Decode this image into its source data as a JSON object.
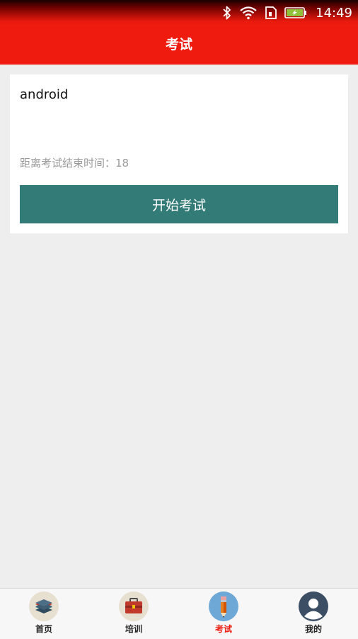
{
  "status_bar": {
    "time": "14:49",
    "icons": [
      "bluetooth-icon",
      "wifi-icon",
      "sim-icon",
      "battery-charging-icon"
    ]
  },
  "app_bar": {
    "title": "考试"
  },
  "exam_card": {
    "name": "android",
    "countdown_label": "距离考试结束时间：",
    "countdown_value": "18",
    "start_button_label": "开始考试"
  },
  "bottom_nav": {
    "items": [
      {
        "label": "首页",
        "icon": "layers-icon",
        "active": false
      },
      {
        "label": "培训",
        "icon": "briefcase-icon",
        "active": false
      },
      {
        "label": "考试",
        "icon": "pencil-icon",
        "active": true
      },
      {
        "label": "我的",
        "icon": "user-icon",
        "active": false
      }
    ]
  },
  "colors": {
    "primary_red": "#ef1b0e",
    "button_teal": "#327b77",
    "background": "#eeeeee"
  }
}
